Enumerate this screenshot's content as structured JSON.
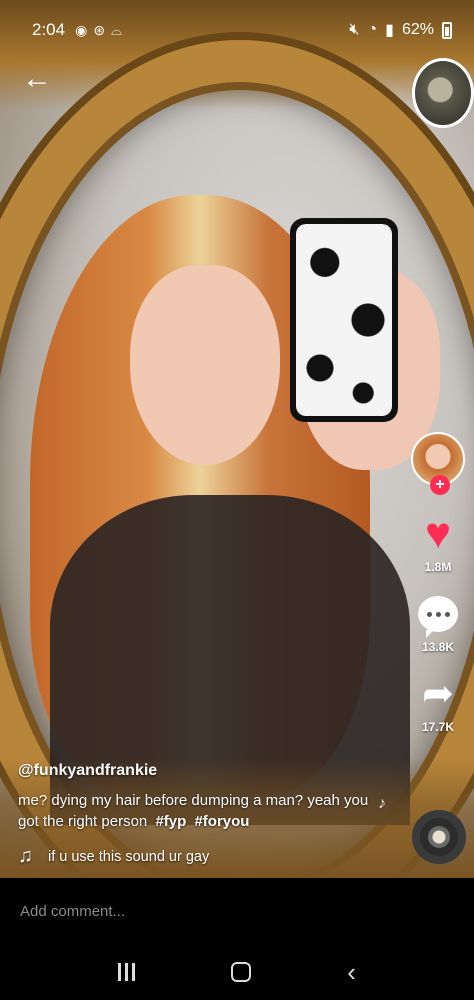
{
  "status_bar": {
    "time": "2:04",
    "battery": "62%",
    "icons": [
      "spotify-icon",
      "app-icon",
      "cloud-icon",
      "mute-icon",
      "wifi-icon",
      "signal-icon",
      "battery-icon"
    ]
  },
  "video": {
    "username": "@funkyandfrankie",
    "description": "me? dying my hair before dumping a man? yeah you got the right person",
    "hashtags": [
      "#fyp",
      "#foryou"
    ],
    "sound": "if u use this sound ur gay"
  },
  "actions": {
    "likes": "1.8M",
    "comments": "13.8K",
    "shares": "17.7K"
  },
  "comment_bar": {
    "placeholder": "Add comment..."
  },
  "colors": {
    "like": "#fe2c55",
    "follow": "#fe2c55",
    "frame_gold": "#b8863a"
  }
}
